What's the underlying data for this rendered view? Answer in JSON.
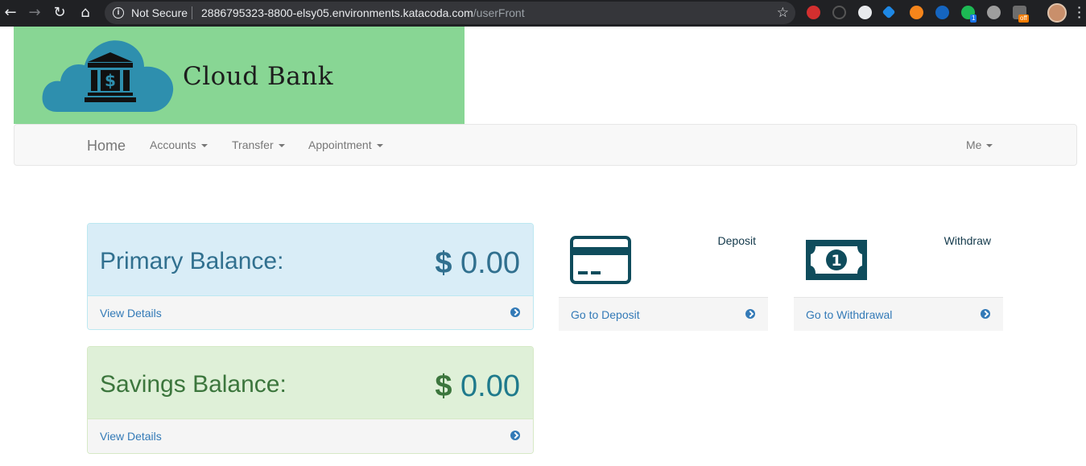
{
  "browser": {
    "security_label": "Not Secure",
    "url_host": "2886795323-8800-elsy05.environments.katacoda.com",
    "url_path": "/userFront",
    "ext_badge_count": "1",
    "ext_badge_off": "off"
  },
  "header": {
    "brand": "Cloud Bank"
  },
  "navbar": {
    "home": "Home",
    "items": [
      "Accounts",
      "Transfer",
      "Appointment"
    ],
    "user_menu": "Me"
  },
  "balances": {
    "primary": {
      "title": "Primary Balance:",
      "currency": "$",
      "amount": "0.00",
      "link": "View Details"
    },
    "savings": {
      "title": "Savings Balance:",
      "currency": "$",
      "amount": "0.00",
      "link": "View Details"
    }
  },
  "actions": {
    "deposit": {
      "label": "Deposit",
      "link": "Go to Deposit",
      "icon": "credit-card-icon"
    },
    "withdraw": {
      "label": "Withdraw",
      "link": "Go to Withdrawal",
      "icon": "money-bill-icon"
    }
  },
  "colors": {
    "banner": "#88d694",
    "primary_panel": "#d9edf7",
    "savings_panel": "#dff0d8",
    "link": "#337ab7",
    "icon_dark": "#0f4c5c"
  }
}
